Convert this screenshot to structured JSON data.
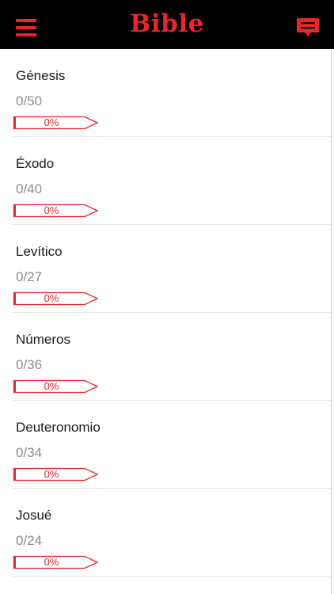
{
  "header": {
    "title": "Bible",
    "menu_icon": "hamburger-menu-icon",
    "chat_icon": "chat-bubble-icon",
    "accent_color": "#e8262b",
    "bar_color": "#000000"
  },
  "books": [
    {
      "name": "Génesis",
      "count": "0/50",
      "progress_label": "0%",
      "progress": 0
    },
    {
      "name": "Éxodo",
      "count": "0/40",
      "progress_label": "0%",
      "progress": 0
    },
    {
      "name": "Levítico",
      "count": "0/27",
      "progress_label": "0%",
      "progress": 0
    },
    {
      "name": "Números",
      "count": "0/36",
      "progress_label": "0%",
      "progress": 0
    },
    {
      "name": "Deuteronomio",
      "count": "0/34",
      "progress_label": "0%",
      "progress": 0
    },
    {
      "name": "Josué",
      "count": "0/24",
      "progress_label": "0%",
      "progress": 0
    }
  ]
}
